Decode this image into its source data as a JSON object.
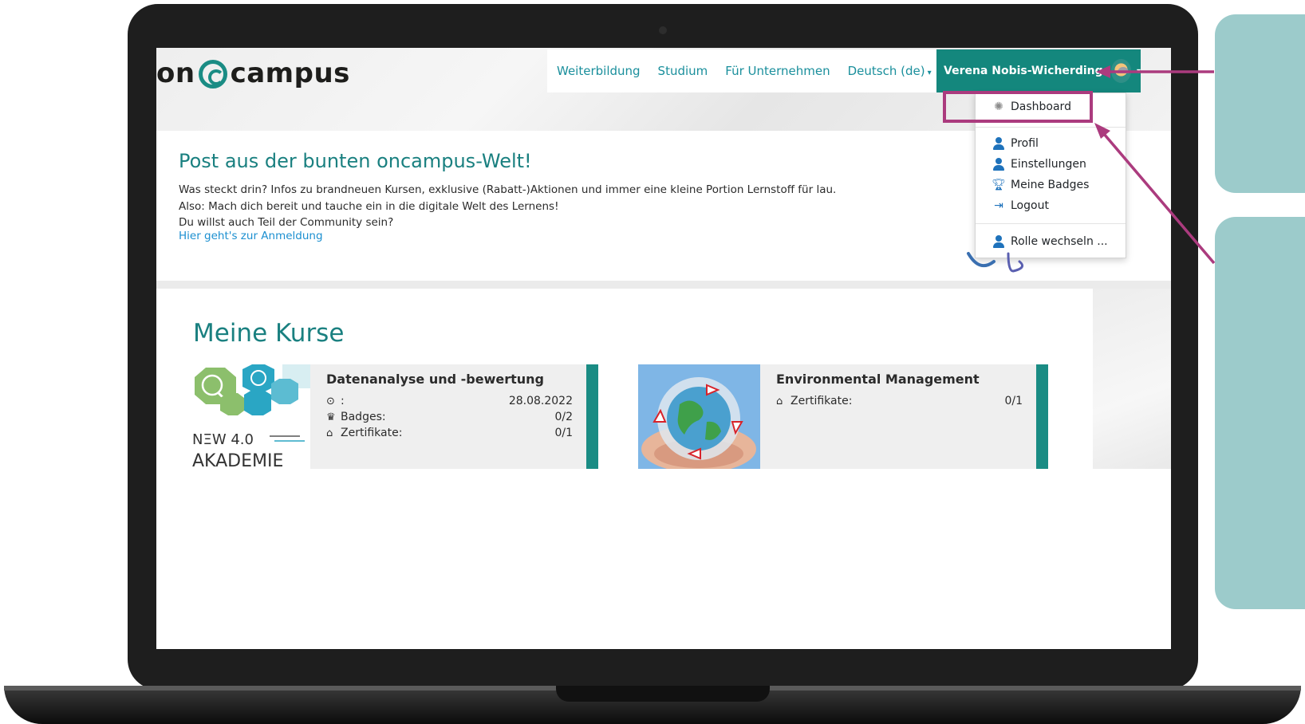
{
  "logo": {
    "prefix": "on",
    "suffix": "campus"
  },
  "nav": {
    "items": [
      "Weiterbildung",
      "Studium",
      "Für Unternehmen"
    ],
    "language": "Deutsch (de)"
  },
  "user": {
    "name": "Verena Nobis-Wicherding"
  },
  "dropdown": {
    "dashboard": "Dashboard",
    "profil": "Profil",
    "einstellungen": "Einstellungen",
    "badges": "Meine Badges",
    "logout": "Logout",
    "rolle": "Rolle wechseln ..."
  },
  "newsletter": {
    "title": "Post aus der bunten oncampus-Welt!",
    "lines": [
      "Was steckt drin? Infos zu brandneuen Kursen, exklusive (Rabatt-)Aktionen und immer eine kleine Portion Lernstoff für lau.",
      "Also: Mach dich bereit und tauche ein in die digitale Welt des Lernens!",
      "Du willst auch Teil der Community sein?"
    ],
    "link": "Hier geht's zur Anmeldung"
  },
  "courses": {
    "title": "Meine Kurse",
    "items": [
      {
        "name": "Datenanalyse und -bewertung",
        "thumb_label_1": "NEW 4.0",
        "thumb_label_2": "AKADEMIE",
        "rows": [
          {
            "label": ":",
            "value": "28.08.2022",
            "icon": "clock-icon"
          },
          {
            "label": "Badges:",
            "value": "0/2",
            "icon": "trophy-icon"
          },
          {
            "label": "Zertifikate:",
            "value": "0/1",
            "icon": "graduation-cap-icon"
          }
        ]
      },
      {
        "name": "Environmental Management",
        "rows": [
          {
            "label": "Zertifikate:",
            "value": "0/1",
            "icon": "graduation-cap-icon"
          }
        ]
      }
    ]
  },
  "colors": {
    "teal": "#14877d",
    "title_teal": "#1a8080",
    "link_blue": "#1b8fd0",
    "highlight_magenta": "#ab3b7e",
    "callout_teal": "#9ccbcb"
  }
}
